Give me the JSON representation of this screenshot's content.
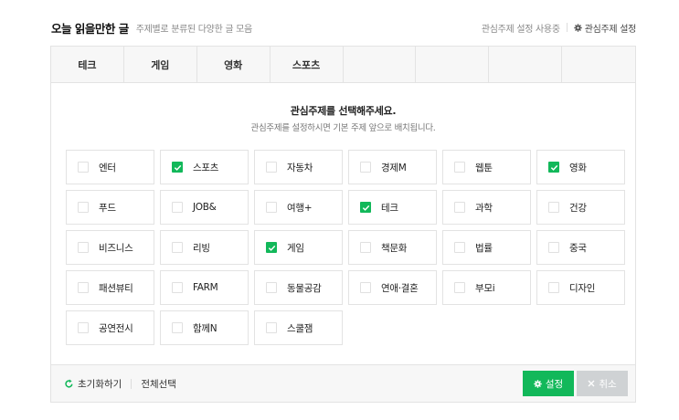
{
  "header": {
    "title": "오늘 읽을만한 글",
    "subtitle": "주제별로 분류된 다양한 글 모음",
    "status": "관심주제 설정 사용중",
    "settings_label": "관심주제 설정"
  },
  "tabs": [
    "테크",
    "게임",
    "영화",
    "스포츠"
  ],
  "prompt": {
    "title": "관심주제를 선택해주세요.",
    "subtitle": "관심주제를 설정하시면 기본 주제 앞으로 배치됩니다."
  },
  "topics": [
    {
      "label": "엔터",
      "checked": false
    },
    {
      "label": "스포츠",
      "checked": true
    },
    {
      "label": "자동차",
      "checked": false
    },
    {
      "label": "경제M",
      "checked": false
    },
    {
      "label": "웹툰",
      "checked": false
    },
    {
      "label": "영화",
      "checked": true
    },
    {
      "label": "푸드",
      "checked": false
    },
    {
      "label": "JOB&",
      "checked": false
    },
    {
      "label": "여행+",
      "checked": false
    },
    {
      "label": "테크",
      "checked": true
    },
    {
      "label": "과학",
      "checked": false
    },
    {
      "label": "건강",
      "checked": false
    },
    {
      "label": "비즈니스",
      "checked": false
    },
    {
      "label": "리빙",
      "checked": false
    },
    {
      "label": "게임",
      "checked": true
    },
    {
      "label": "책문화",
      "checked": false
    },
    {
      "label": "법률",
      "checked": false
    },
    {
      "label": "중국",
      "checked": false
    },
    {
      "label": "패션뷰티",
      "checked": false
    },
    {
      "label": "FARM",
      "checked": false
    },
    {
      "label": "동물공감",
      "checked": false
    },
    {
      "label": "연애·결혼",
      "checked": false
    },
    {
      "label": "부모i",
      "checked": false
    },
    {
      "label": "디자인",
      "checked": false
    },
    {
      "label": "공연전시",
      "checked": false
    },
    {
      "label": "함께N",
      "checked": false
    },
    {
      "label": "스쿨잼",
      "checked": false
    }
  ],
  "footer": {
    "reset_label": "초기화하기",
    "select_all_label": "전체선택",
    "save_label": "설정",
    "cancel_label": "취소"
  },
  "colors": {
    "accent": "#12b85a",
    "cancel_bg": "#cfd2d4",
    "border": "#e3e3e3"
  }
}
